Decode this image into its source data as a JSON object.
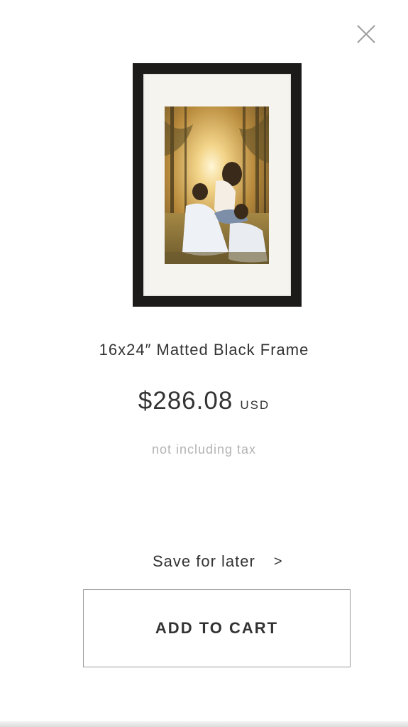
{
  "modal": {
    "close_icon": "close-icon"
  },
  "product": {
    "image_alt": "framed family photo",
    "title": "16x24″ Matted Black Frame",
    "price": "$286.08",
    "currency": "USD",
    "tax_note": "not including tax",
    "frame_color": "#1c1b1a",
    "mat_color": "#f6f4ef"
  },
  "actions": {
    "save_for_later_label": "Save for later",
    "save_for_later_icon": "chevron-right-icon",
    "save_for_later_glyph": ">",
    "add_to_cart_label": "ADD TO CART"
  }
}
